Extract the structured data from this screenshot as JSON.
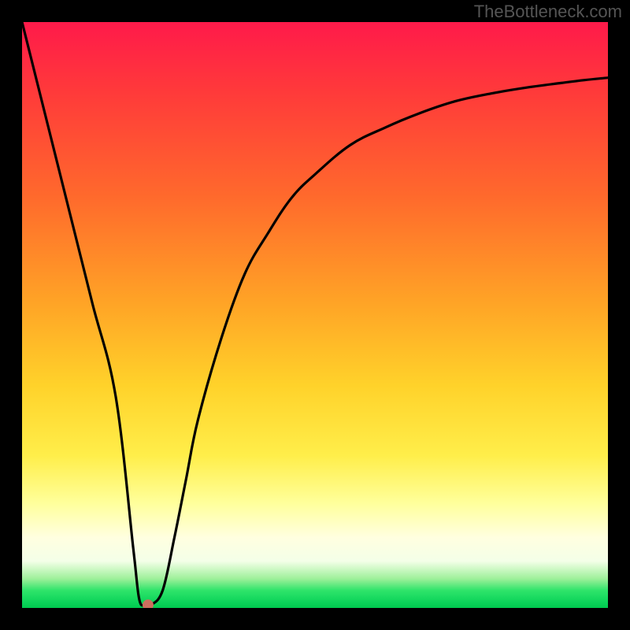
{
  "watermark": "TheBottleneck.com",
  "chart_data": {
    "type": "line",
    "title": "",
    "xlabel": "",
    "ylabel": "",
    "xlim": [
      0,
      100
    ],
    "ylim": [
      0,
      100
    ],
    "grid": false,
    "series": [
      {
        "name": "curve",
        "x": [
          0,
          4,
          8,
          12,
          16,
          19,
          20,
          21,
          22,
          24,
          26,
          28,
          30,
          34,
          38,
          42,
          46,
          50,
          56,
          62,
          68,
          74,
          80,
          86,
          92,
          96,
          100
        ],
        "values": [
          100,
          84,
          68,
          52,
          36,
          10,
          1.5,
          0.5,
          0.5,
          3,
          12,
          22,
          32,
          46,
          57,
          64,
          70,
          74,
          79,
          82,
          84.5,
          86.5,
          87.8,
          88.8,
          89.6,
          90.1,
          90.5
        ]
      }
    ],
    "marker": {
      "x": 21.5,
      "y": 0.5,
      "color": "#cc6f5e"
    },
    "background_gradient": {
      "direction": "top-to-bottom",
      "stops": [
        {
          "pos": 0,
          "color": "#ff1a4a"
        },
        {
          "pos": 50,
          "color": "#ffb030"
        },
        {
          "pos": 80,
          "color": "#ffff80"
        },
        {
          "pos": 95,
          "color": "#7fe890"
        },
        {
          "pos": 100,
          "color": "#00c94f"
        }
      ]
    }
  }
}
